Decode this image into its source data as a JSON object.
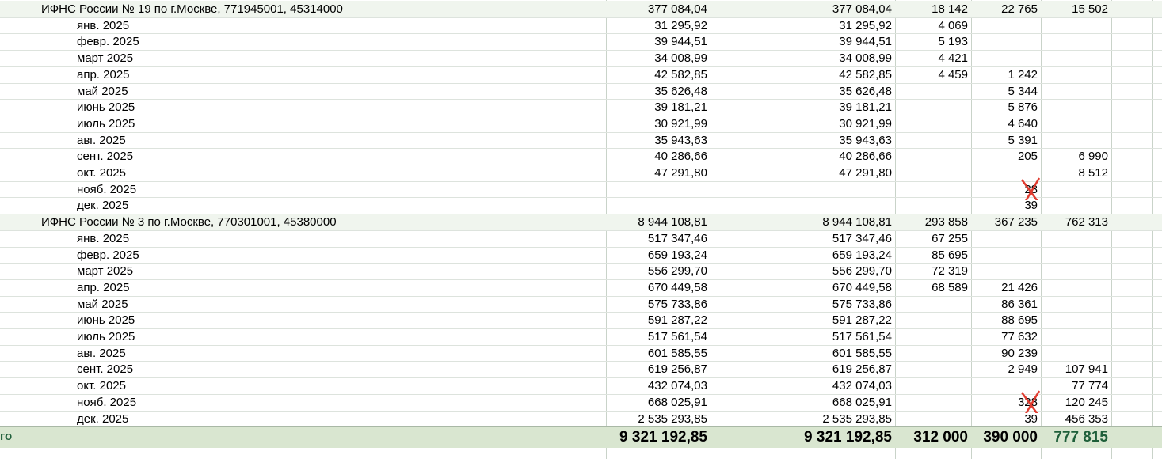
{
  "groups": [
    {
      "name": "ИФНС России № 19 по г.Москве, 771945001, 45314000",
      "c1": "377 084,04",
      "c2": "377 084,04",
      "c3": "18 142",
      "c4": "22 765",
      "c5": "15 502",
      "months": [
        {
          "m": "янв. 2025",
          "c1": "31 295,92",
          "c2": "31 295,92",
          "c3": "4 069",
          "c4": "",
          "c5": ""
        },
        {
          "m": "февр. 2025",
          "c1": "39 944,51",
          "c2": "39 944,51",
          "c3": "5 193",
          "c4": "",
          "c5": ""
        },
        {
          "m": "март 2025",
          "c1": "34 008,99",
          "c2": "34 008,99",
          "c3": "4 421",
          "c4": "",
          "c5": ""
        },
        {
          "m": "апр. 2025",
          "c1": "42 582,85",
          "c2": "42 582,85",
          "c3": "4 459",
          "c4": "1 242",
          "c5": ""
        },
        {
          "m": "май 2025",
          "c1": "35 626,48",
          "c2": "35 626,48",
          "c3": "",
          "c4": "5 344",
          "c5": ""
        },
        {
          "m": "июнь 2025",
          "c1": "39 181,21",
          "c2": "39 181,21",
          "c3": "",
          "c4": "5 876",
          "c5": ""
        },
        {
          "m": "июль 2025",
          "c1": "30 921,99",
          "c2": "30 921,99",
          "c3": "",
          "c4": "4 640",
          "c5": ""
        },
        {
          "m": "авг. 2025",
          "c1": "35 943,63",
          "c2": "35 943,63",
          "c3": "",
          "c4": "5 391",
          "c5": ""
        },
        {
          "m": "сент. 2025",
          "c1": "40 286,66",
          "c2": "40 286,66",
          "c3": "",
          "c4": "205",
          "c5": "6 990"
        },
        {
          "m": "окт. 2025",
          "c1": "47 291,80",
          "c2": "47 291,80",
          "c3": "",
          "c4": "",
          "c5": "8 512"
        },
        {
          "m": "нояб. 2025",
          "c1": "",
          "c2": "",
          "c3": "",
          "c4": "28",
          "c5": ""
        },
        {
          "m": "дек. 2025",
          "c1": "",
          "c2": "",
          "c3": "",
          "c4": "39",
          "c5": ""
        }
      ]
    },
    {
      "name": "ИФНС России № 3 по г.Москве, 770301001, 45380000",
      "c1": "8 944 108,81",
      "c2": "8 944 108,81",
      "c3": "293 858",
      "c4": "367 235",
      "c5": "762 313",
      "months": [
        {
          "m": "янв. 2025",
          "c1": "517 347,46",
          "c2": "517 347,46",
          "c3": "67 255",
          "c4": "",
          "c5": ""
        },
        {
          "m": "февр. 2025",
          "c1": "659 193,24",
          "c2": "659 193,24",
          "c3": "85 695",
          "c4": "",
          "c5": ""
        },
        {
          "m": "март 2025",
          "c1": "556 299,70",
          "c2": "556 299,70",
          "c3": "72 319",
          "c4": "",
          "c5": ""
        },
        {
          "m": "апр. 2025",
          "c1": "670 449,58",
          "c2": "670 449,58",
          "c3": "68 589",
          "c4": "21 426",
          "c5": ""
        },
        {
          "m": "май 2025",
          "c1": "575 733,86",
          "c2": "575 733,86",
          "c3": "",
          "c4": "86 361",
          "c5": ""
        },
        {
          "m": "июнь 2025",
          "c1": "591 287,22",
          "c2": "591 287,22",
          "c3": "",
          "c4": "88 695",
          "c5": ""
        },
        {
          "m": "июль 2025",
          "c1": "517 561,54",
          "c2": "517 561,54",
          "c3": "",
          "c4": "77 632",
          "c5": ""
        },
        {
          "m": "авг. 2025",
          "c1": "601 585,55",
          "c2": "601 585,55",
          "c3": "",
          "c4": "90 239",
          "c5": ""
        },
        {
          "m": "сент. 2025",
          "c1": "619 256,87",
          "c2": "619 256,87",
          "c3": "",
          "c4": "2 949",
          "c5": "107 941"
        },
        {
          "m": "окт. 2025",
          "c1": "432 074,03",
          "c2": "432 074,03",
          "c3": "",
          "c4": "",
          "c5": "77 774"
        },
        {
          "m": "нояб. 2025",
          "c1": "668 025,91",
          "c2": "668 025,91",
          "c3": "",
          "c4": "328",
          "c5": "120 245"
        },
        {
          "m": "дек. 2025",
          "c1": "2 535 293,85",
          "c2": "2 535 293,85",
          "c3": "",
          "c4": "39",
          "c5": "456 353"
        }
      ]
    }
  ],
  "total": {
    "label": "го",
    "c1": "9 321 192,85",
    "c2": "9 321 192,85",
    "c3": "312 000",
    "c4": "390 000",
    "c5": "777 815"
  },
  "colors": {
    "group_bg": "#f0f5ee",
    "total_bg": "#d9e6d0",
    "total_label": "#1f5f3a",
    "cross": "#e03b2f"
  },
  "annotations": [
    {
      "type": "cross-out",
      "note": "red X over value",
      "group": 0,
      "month": 10
    },
    {
      "type": "cross-out",
      "note": "red X over value",
      "group": 1,
      "month": 10
    }
  ]
}
